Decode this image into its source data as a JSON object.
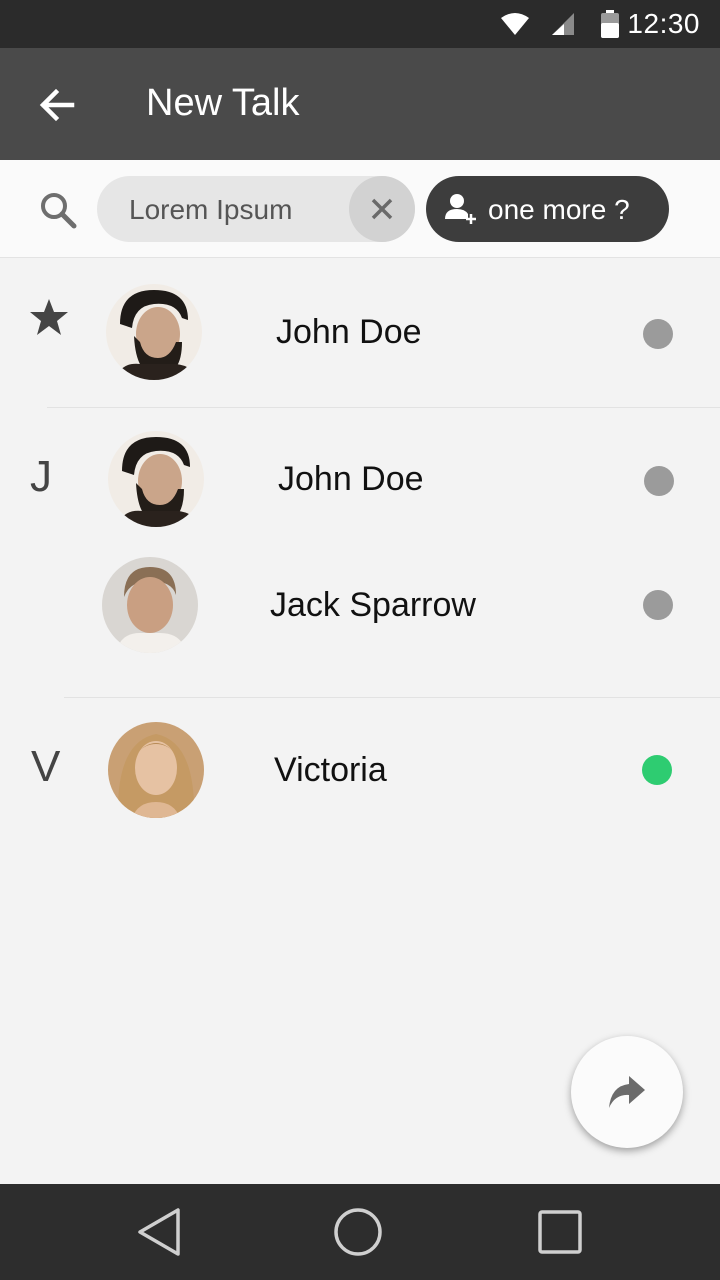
{
  "status_bar": {
    "time": "12:30",
    "icons": [
      "wifi-icon",
      "cell-signal-icon",
      "battery-icon"
    ]
  },
  "app_bar": {
    "back_icon": "arrow-back-icon",
    "title": "New Talk"
  },
  "search": {
    "icon": "search-icon",
    "chip_text": "Lorem Ipsum",
    "clear_icon": "close-icon",
    "add_button_icon": "add-person-icon",
    "add_button_label": "one more ?"
  },
  "sections": [
    {
      "marker": "star-icon",
      "contacts": [
        {
          "name": "John Doe",
          "status": "offline"
        }
      ]
    },
    {
      "marker": "J",
      "contacts": [
        {
          "name": "John Doe",
          "status": "offline"
        },
        {
          "name": "Jack Sparrow",
          "status": "offline"
        }
      ]
    },
    {
      "marker": "V",
      "contacts": [
        {
          "name": "Victoria",
          "status": "online"
        }
      ]
    }
  ],
  "colors": {
    "offline": "#9b9b9b",
    "online": "#2ecc71",
    "app_bar": "#4a4a4a",
    "status_bar": "#2b2b2b"
  },
  "fab": {
    "icon": "forward-icon"
  },
  "nav_bar": {
    "icons": [
      "nav-back-icon",
      "nav-home-icon",
      "nav-recents-icon"
    ]
  }
}
